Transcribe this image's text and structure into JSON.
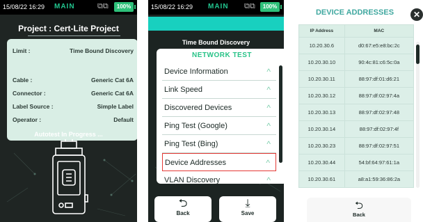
{
  "screen1": {
    "status": {
      "time": "15/08/22 16:29",
      "mode": "MAIN",
      "battery": "100%"
    },
    "project_title": "Project : Cert-Lite Project",
    "info": [
      {
        "key": "Limit :",
        "value": "Time Bound Discovery"
      },
      {
        "key": "Cable :",
        "value": "Generic Cat 6A"
      },
      {
        "key": "Connector :",
        "value": "Generic Cat 6A"
      },
      {
        "key": "Label Source :",
        "value": "Simple Label"
      },
      {
        "key": "Operator :",
        "value": "Default"
      }
    ],
    "autotest_text": "Autotest In Progress ..."
  },
  "screen2": {
    "status": {
      "time": "15/08/22 16:29",
      "mode": "MAIN",
      "battery": "100%"
    },
    "title": "Time Bound Discovery",
    "card_header": "NETWORK TEST",
    "items": [
      {
        "label": "Device Information"
      },
      {
        "label": "Link Speed"
      },
      {
        "label": "Discovered Devices"
      },
      {
        "label": "Ping Test (Google)"
      },
      {
        "label": "Ping Test (Bing)"
      },
      {
        "label": "Device Addresses"
      },
      {
        "label": "VLAN Discovery"
      }
    ],
    "highlighted_item": "Device Addresses",
    "buttons": {
      "back": "Back",
      "save": "Save"
    }
  },
  "screen3": {
    "title": "DEVICE ADDRESSES",
    "columns": [
      "IP Address",
      "MAC"
    ],
    "rows": [
      [
        "10.20.30.6",
        "d0:67:e5:e8:bc:2c"
      ],
      [
        "10.20.30.10",
        "90:4c:81:c6:5c:0a"
      ],
      [
        "10.20.30.11",
        "88:97:df:01:d6:21"
      ],
      [
        "10.20.30.12",
        "88:97:df:02:97:4a"
      ],
      [
        "10.20.30.13",
        "88:97:df:02:97:48"
      ],
      [
        "10.20.30.14",
        "88:97:df:02:97:4f"
      ],
      [
        "10.20.30.23",
        "88:97:df:02:97:51"
      ],
      [
        "10.20.30.44",
        "54:bf:64:97:61:1a"
      ],
      [
        "10.20.30.61",
        "a8:a1:59:36:86:2a"
      ]
    ],
    "back_label": "Back"
  },
  "colors": {
    "accent_green": "#28c388",
    "teal": "#18d0bf",
    "highlight_red": "#e53935",
    "battery_green": "#2ec07a"
  },
  "icons": {
    "back": "back-arrow-icon",
    "save": "download-icon",
    "close": "close-icon",
    "devices": "two-device-icon",
    "tester": "handheld-tester-icon"
  }
}
